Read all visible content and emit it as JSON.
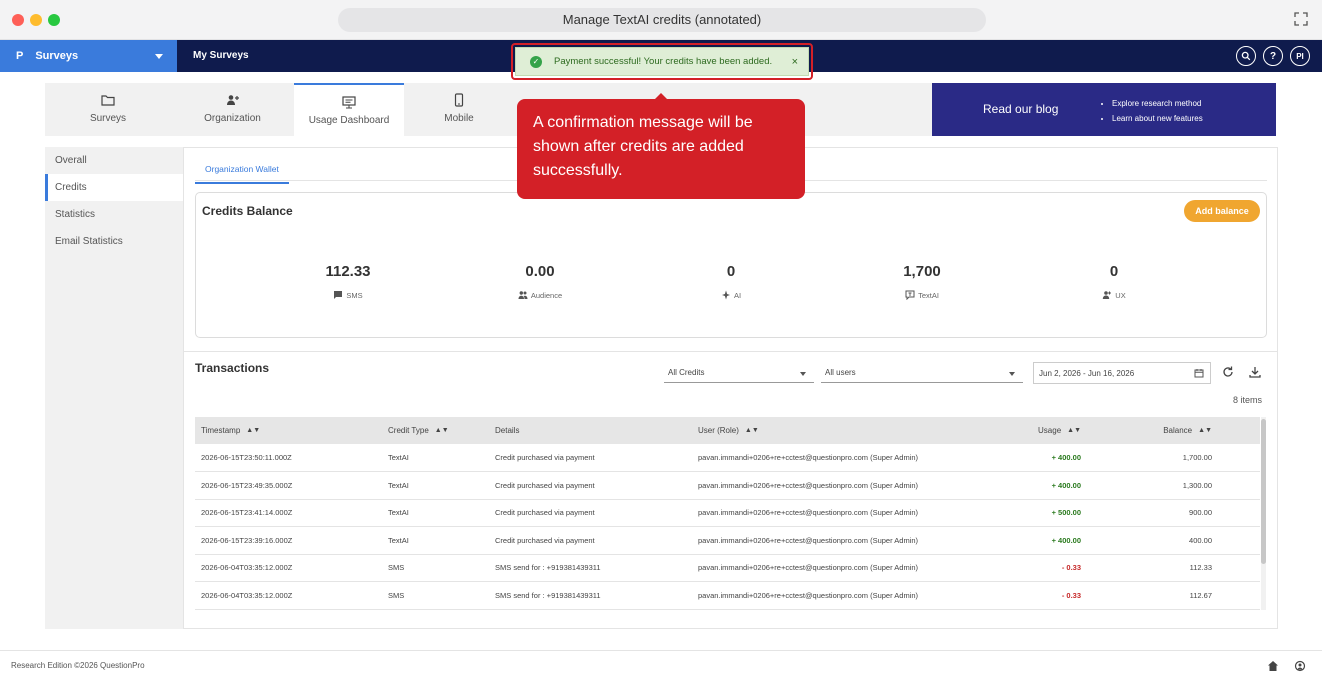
{
  "window": {
    "title": "Manage TextAI credits (annotated)"
  },
  "nav": {
    "product_logo": "P",
    "product_label": "Surveys",
    "link_label": "My Surveys",
    "help_label": "?",
    "profile_initials": "PI"
  },
  "toast": {
    "message": "Payment successful! Your credits have been added.",
    "close_label": "×",
    "success_color": "#35a34a"
  },
  "callout": {
    "text": "A confirmation message will be shown after credits are added successfully."
  },
  "modules": [
    {
      "label": "Surveys",
      "icon": "folder-icon"
    },
    {
      "label": "Organization",
      "icon": "add-user-icon"
    },
    {
      "label": "Usage Dashboard",
      "icon": "monitor-icon",
      "active": true
    },
    {
      "label": "Mobile",
      "icon": "mobile-icon"
    }
  ],
  "blog": {
    "title": "Read our blog",
    "items": [
      "Explore research method",
      "Learn about new features"
    ]
  },
  "sidebar": {
    "items": [
      {
        "label": "Overall"
      },
      {
        "label": "Credits",
        "active": true
      },
      {
        "label": "Statistics"
      },
      {
        "label": "Email Statistics"
      }
    ]
  },
  "wallet": {
    "tab_label": "Organization Wallet"
  },
  "balance": {
    "title": "Credits Balance",
    "add_button": "Add balance",
    "metrics": [
      {
        "value": "112.33",
        "label": "SMS",
        "icon": "message-icon"
      },
      {
        "value": "0.00",
        "label": "Audience",
        "icon": "people-icon"
      },
      {
        "value": "0",
        "label": "AI",
        "icon": "sparkle-icon"
      },
      {
        "value": "1,700",
        "label": "TextAI",
        "icon": "textai-icon"
      },
      {
        "value": "0",
        "label": "UX",
        "icon": "ux-icon"
      }
    ]
  },
  "transactions": {
    "title": "Transactions",
    "credit_filter": "All Credits",
    "user_filter": "All users",
    "date_range": "Jun 2, 2026 - Jun 16, 2026",
    "items_count": "8 items",
    "columns": [
      "Timestamp",
      "Credit Type",
      "Details",
      "User (Role)",
      "Usage",
      "Balance"
    ],
    "rows": [
      {
        "timestamp": "2026-06-15T23:50:11.000Z",
        "type": "TextAI",
        "details": "Credit purchased via payment",
        "user": "pavan.immandi+0206+re+cctest@questionpro.com (Super Admin)",
        "usage": "+ 400.00",
        "sign": "pos",
        "balance": "1,700.00"
      },
      {
        "timestamp": "2026-06-15T23:49:35.000Z",
        "type": "TextAI",
        "details": "Credit purchased via payment",
        "user": "pavan.immandi+0206+re+cctest@questionpro.com (Super Admin)",
        "usage": "+ 400.00",
        "sign": "pos",
        "balance": "1,300.00"
      },
      {
        "timestamp": "2026-06-15T23:41:14.000Z",
        "type": "TextAI",
        "details": "Credit purchased via payment",
        "user": "pavan.immandi+0206+re+cctest@questionpro.com (Super Admin)",
        "usage": "+ 500.00",
        "sign": "pos",
        "balance": "900.00"
      },
      {
        "timestamp": "2026-06-15T23:39:16.000Z",
        "type": "TextAI",
        "details": "Credit purchased via payment",
        "user": "pavan.immandi+0206+re+cctest@questionpro.com (Super Admin)",
        "usage": "+ 400.00",
        "sign": "pos",
        "balance": "400.00"
      },
      {
        "timestamp": "2026-06-04T03:35:12.000Z",
        "type": "SMS",
        "details": "SMS send for : +919381439311",
        "user": "pavan.immandi+0206+re+cctest@questionpro.com (Super Admin)",
        "usage": "- 0.33",
        "sign": "neg",
        "balance": "112.33"
      },
      {
        "timestamp": "2026-06-04T03:35:12.000Z",
        "type": "SMS",
        "details": "SMS send for : +919381439311",
        "user": "pavan.immandi+0206+re+cctest@questionpro.com (Super Admin)",
        "usage": "- 0.33",
        "sign": "neg",
        "balance": "112.67"
      }
    ]
  },
  "footer": {
    "text": "Research Edition ©2026 QuestionPro"
  }
}
